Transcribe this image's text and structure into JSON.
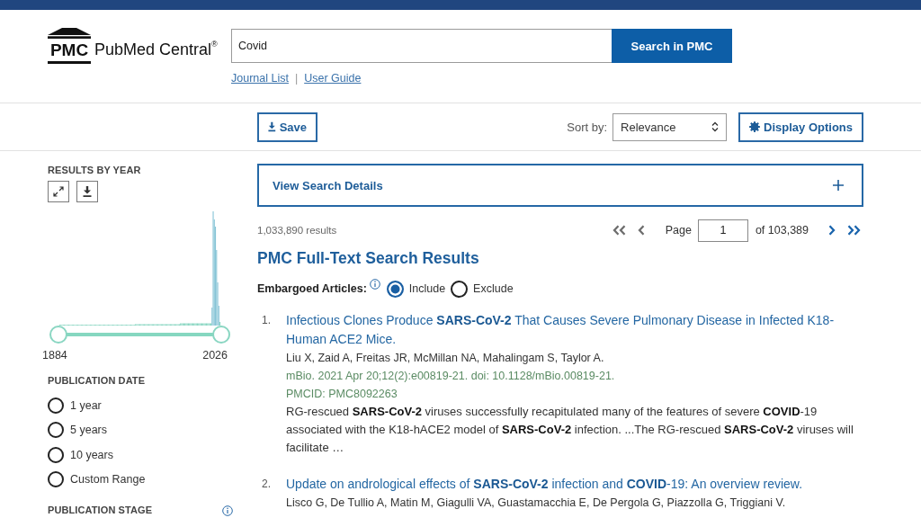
{
  "header": {
    "logo": {
      "abbreviation": "PMC",
      "name": "PubMed Central$^{®}$"
    },
    "search": {
      "value": "Covid",
      "button": "Search in PMC"
    },
    "links": [
      {
        "label": "Journal List"
      },
      {
        "label": "User Guide"
      }
    ],
    "link_separator": "|"
  },
  "toolbar": {
    "save_button": "Save",
    "sort": {
      "label": "Sort by:",
      "value": "Relevance"
    },
    "display_options_button": "Display Options"
  },
  "sidebar": {
    "results_by_year": {
      "title": "RESULTS BY YEAR",
      "year_range": {
        "start": "1884",
        "end": "2026",
        "level": 1
      }
    },
    "publication_date": {
      "title": "PUBLICATION DATE",
      "options": [
        {
          "label": "1 year",
          "selected": false
        },
        {
          "label": "5 years",
          "selected": false
        },
        {
          "label": "10 years",
          "selected": false
        },
        {
          "label": "Custom Range",
          "selected": false
        }
      ]
    },
    "publication_stage": {
      "title": "PUBLICATION STAGE"
    }
  },
  "main": {
    "search_details": {
      "label": "View Search Details",
      "expanded": false
    },
    "result_count": "1,033,890 results",
    "pager": {
      "buttons": [
        {
          "kind": "first",
          "disabled": true
        },
        {
          "kind": "previous",
          "disabled": true
        },
        {
          "kind": "next",
          "disabled": false
        },
        {
          "kind": "last",
          "disabled": false
        }
      ],
      "page_label": "Page",
      "page": "1",
      "total": "of 103,389"
    },
    "heading": "PMC Full-Text Search Results",
    "embargoed": {
      "label": "Embargoed Articles:",
      "options": [
        {
          "label": "Include",
          "selected": true
        },
        {
          "label": "Exclude",
          "selected": false
        }
      ]
    },
    "results": [
      {
        "number": "1.",
        "title": "Infectious Clones Produce **SARS-CoV-2** That Causes Severe Pulmonary Disease in Infected K18-Human ACE2 Mice.",
        "authors": "Liu X, Zaid A, Freitas JR, McMillan NA, Mahalingam S, Taylor A.",
        "citation": "mBio. 2021 Apr 20;12(2):e00819-21. doi: 10.1128/mBio.00819-21.",
        "pmcid": "PMCID: PMC8092263",
        "snippet": "RG-rescued **SARS-CoV-2** viruses successfully recapitulated many of the features of severe **COVID**-19 associated with the K18-hACE2 model of **SARS-CoV-2** infection. ...The RG-rescued **SARS-CoV-2** viruses will facilitate …"
      },
      {
        "number": "2.",
        "title": "Update on andrological effects of **SARS-CoV-2** infection and **COVID**-19: An overview review.",
        "authors": "Lisco G, De Tullio A, Matin M, Giagulli VA, Guastamacchia E, De Pergola G, Piazzolla G, Triggiani V."
      }
    ]
  }
}
